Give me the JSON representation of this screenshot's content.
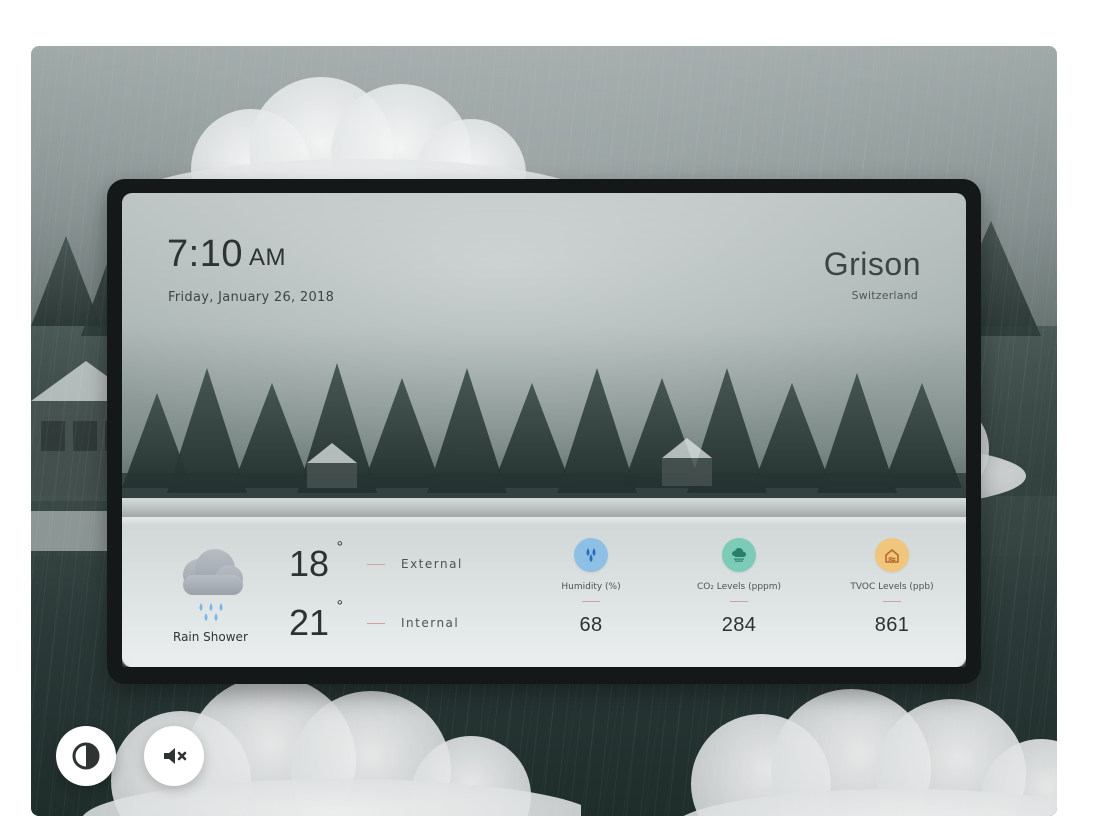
{
  "stage": {
    "colors": {
      "accent_pink": "#d2a2a2",
      "humidity_icon_bg": "#8ebfe5",
      "co2_icon_bg": "#7ccbb8",
      "tvoc_icon_bg": "#f0c57c"
    }
  },
  "display": {
    "time": {
      "value": "7:10",
      "ampm": "AM"
    },
    "date": "Friday, January 26, 2018",
    "location": {
      "title": "Grison",
      "subtitle": "Switzerland"
    },
    "condition": {
      "label": "Rain Shower",
      "icon": "rain-cloud-icon"
    },
    "temperatures": [
      {
        "value": "18",
        "label": "External"
      },
      {
        "value": "21",
        "label": "Internal"
      }
    ],
    "metrics": [
      {
        "icon": "humidity-icon",
        "label": "Humidity (%)",
        "value": "68"
      },
      {
        "icon": "co2-icon",
        "label": "CO₂ Levels (pppm)",
        "value": "284"
      },
      {
        "icon": "tvoc-icon",
        "label": "TVOC Levels (ppb)",
        "value": "861"
      }
    ]
  },
  "controls": {
    "contrast": {
      "icon": "contrast-icon"
    },
    "mute": {
      "icon": "mute-icon"
    }
  }
}
